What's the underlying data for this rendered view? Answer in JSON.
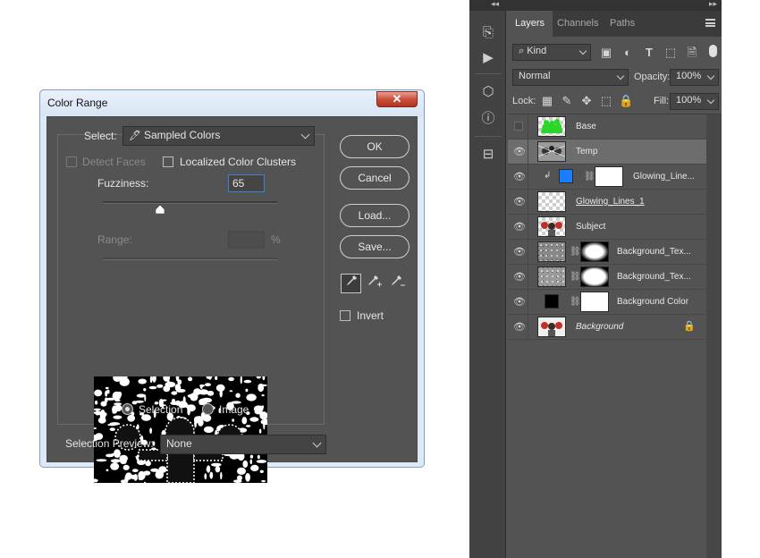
{
  "dialog": {
    "title": "Color Range",
    "close_label": "✕",
    "select_label": "Select:",
    "select_value": "Sampled Colors",
    "detect_faces_label": "Detect Faces",
    "localized_label": "Localized Color Clusters",
    "fuzziness_label": "Fuzziness:",
    "fuzziness_value": "65",
    "fuzziness_level": 0.33,
    "range_label": "Range:",
    "range_unit": "%",
    "selection_radio_label": "Selection",
    "image_radio_label": "Image",
    "preview_label": "Selection Preview:",
    "preview_value": "None",
    "ok_label": "OK",
    "cancel_label": "Cancel",
    "load_label": "Load...",
    "save_label": "Save...",
    "invert_label": "Invert"
  },
  "panel": {
    "tabs": [
      "Layers",
      "Channels",
      "Paths"
    ],
    "kind_label": "Kind",
    "blend_mode": "Normal",
    "opacity_label": "Opacity:",
    "opacity_value": "100%",
    "lock_label": "Lock:",
    "fill_label": "Fill:",
    "fill_value": "100%",
    "layers": [
      {
        "name": "Base",
        "visible": false
      },
      {
        "name": "Temp",
        "visible": true,
        "selected": true
      },
      {
        "name": "Glowing_Line...",
        "visible": true,
        "fill_color": "#1a7cff"
      },
      {
        "name": "Glowing_Lines_1",
        "visible": true
      },
      {
        "name": "Subject",
        "visible": true
      },
      {
        "name": "Background_Tex...",
        "visible": true
      },
      {
        "name": "Background_Tex...",
        "visible": true
      },
      {
        "name": "Background Color",
        "visible": true,
        "fill_color": "#000000"
      },
      {
        "name": "Background",
        "visible": true,
        "locked": true
      }
    ]
  }
}
